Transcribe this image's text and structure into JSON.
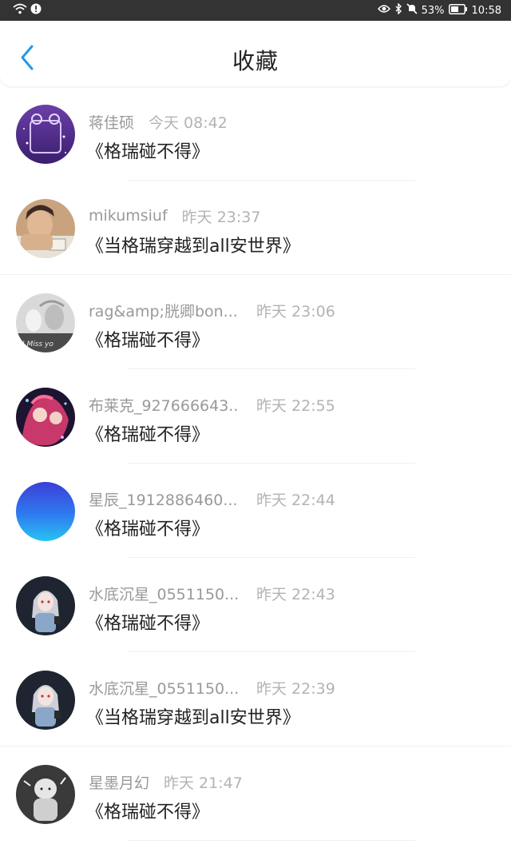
{
  "status_bar": {
    "battery_percent": "53%",
    "time": "10:58",
    "icons": [
      "wifi-icon",
      "alert-icon",
      "eye-icon",
      "bluetooth-icon",
      "mute-icon",
      "battery-icon"
    ]
  },
  "header": {
    "title": "收藏",
    "back_icon": "chevron-left-icon",
    "accent_color": "#1e9be8"
  },
  "items": [
    {
      "name": "蒋佳硕",
      "time": "今天 08:42",
      "book": "《格瑞碰不得》",
      "avatar": "purple-night-avatar"
    },
    {
      "name": "mikumsiuf",
      "time": "昨天 23:37",
      "book": "《当格瑞穿越到all安世界》",
      "avatar": "photo-person-avatar"
    },
    {
      "name": "rag&amp;胱卿bon...",
      "time": "昨天 23:06",
      "book": "《格瑞碰不得》",
      "avatar": "grey-miss-you-avatar"
    },
    {
      "name": "布莱克_927666643..",
      "time": "昨天 22:55",
      "book": "《格瑞碰不得》",
      "avatar": "pink-anime-avatar"
    },
    {
      "name": "星辰_1912886460...",
      "time": "昨天 22:44",
      "book": "《格瑞碰不得》",
      "avatar": "blue-gradient-avatar"
    },
    {
      "name": "水底沉星_0551150...",
      "time": "昨天 22:43",
      "book": "《格瑞碰不得》",
      "avatar": "anime-girl-avatar"
    },
    {
      "name": "水底沉星_0551150...",
      "time": "昨天 22:39",
      "book": "《当格瑞穿越到all安世界》",
      "avatar": "anime-girl-avatar"
    },
    {
      "name": "星墨月幻",
      "time": "昨天 21:47",
      "book": "《格瑞碰不得》",
      "avatar": "sketch-character-avatar"
    }
  ]
}
